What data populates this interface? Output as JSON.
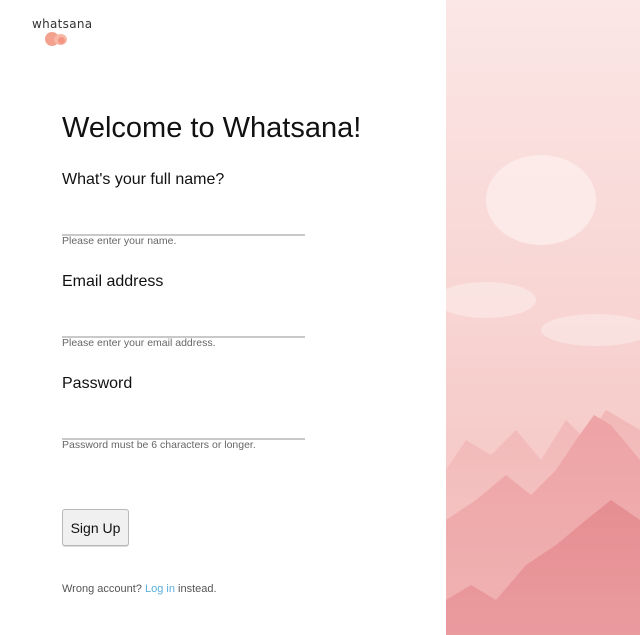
{
  "brand": {
    "name": "whatsana"
  },
  "heading": "Welcome to Whatsana!",
  "form": {
    "name": {
      "label": "What's your full name?",
      "value": "",
      "hint": "Please enter your name."
    },
    "email": {
      "label": "Email address",
      "value": "",
      "hint": "Please enter your email address."
    },
    "password": {
      "label": "Password",
      "value": "",
      "hint": "Password must be 6 characters or longer."
    },
    "submit_label": "Sign Up"
  },
  "footer": {
    "prefix": "Wrong account? ",
    "link": "Log in",
    "suffix": " instead."
  },
  "colors": {
    "accent_link": "#5ab0dc",
    "logo": "#f2a28f",
    "art_base": "#f6c9c7",
    "art_mountain": "#e99a9c"
  },
  "icons": {
    "logo": "whatsana-logo-icon"
  }
}
